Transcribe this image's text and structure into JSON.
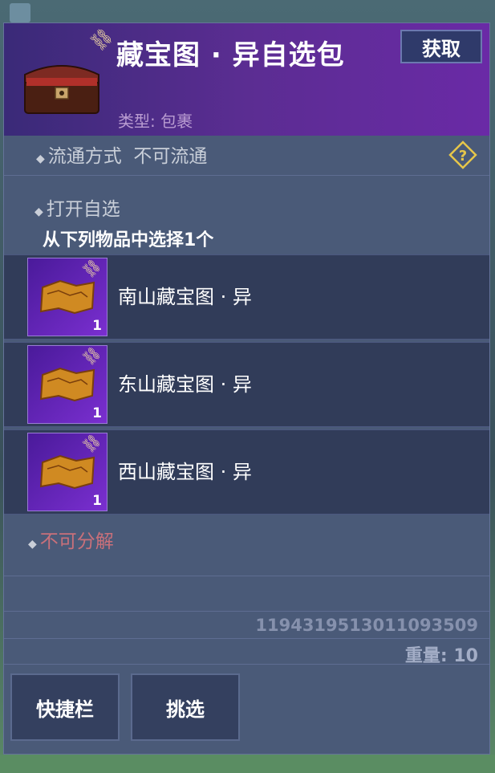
{
  "header": {
    "title": "藏宝图 · 异自选包",
    "get_button": "获取",
    "type_label": "类型: 包裹"
  },
  "circulation": {
    "label": "流通方式",
    "value": "不可流通"
  },
  "open_choice": {
    "label": "打开自选",
    "instruction": "从下列物品中选择1个"
  },
  "items": [
    {
      "name": "南山藏宝图 · 异",
      "count": "1"
    },
    {
      "name": "东山藏宝图 · 异",
      "count": "1"
    },
    {
      "name": "西山藏宝图 · 异",
      "count": "1"
    }
  ],
  "decompose": "不可分解",
  "serial": "1194319513011093509",
  "weight": "重量: 10",
  "buttons": {
    "shortcut": "快捷栏",
    "select": "挑选"
  },
  "icons": {
    "chest": "treasure-chest-icon",
    "link": "chain-link-icon",
    "help": "question-diamond-icon",
    "map": "treasure-map-icon"
  },
  "colors": {
    "header_purple": "#5b2d92",
    "panel": "#4a5a78",
    "item_row": "#313c59",
    "item_icon_purple": "#7a2fd0",
    "warning_red": "#c9707a"
  }
}
